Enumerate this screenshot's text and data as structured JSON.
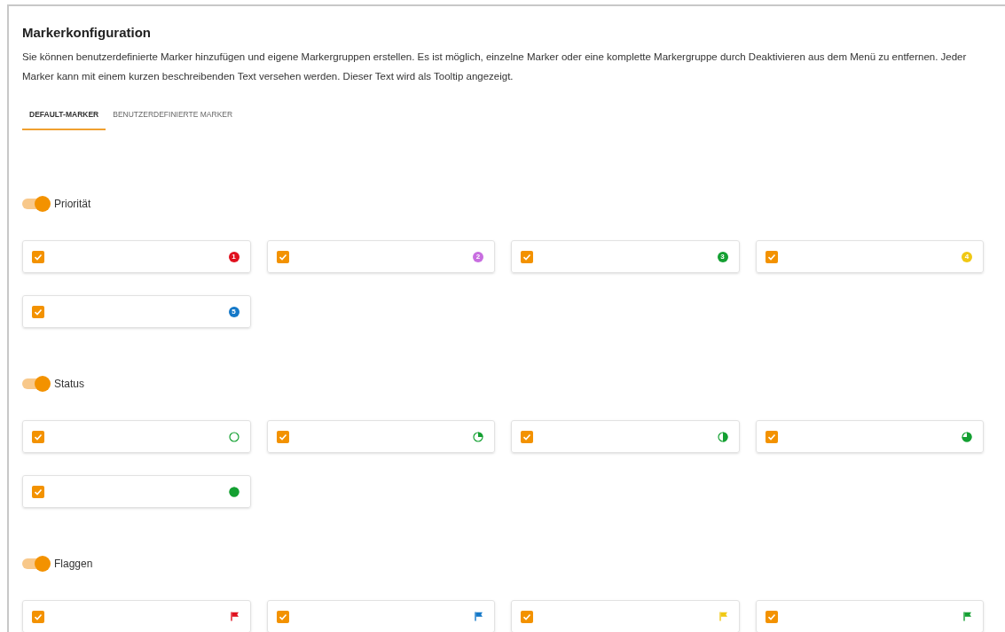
{
  "title": "Markerkonfiguration",
  "description": "Sie können benutzerdefinierte Marker hinzufügen und eigene Markergruppen erstellen. Es ist möglich, einzelne Marker oder eine komplette Markergruppe durch Deaktivieren aus dem Menü zu entfernen. Jeder Marker kann mit einem kurzen beschreibenden Text versehen werden. Dieser Text wird als Tooltip angezeigt.",
  "tabs": [
    {
      "label": "DEFAULT-MARKER",
      "selected": true
    },
    {
      "label": "BENUTZERDEFINIERTE MARKER",
      "selected": false
    }
  ],
  "groups": [
    {
      "label": "Priorität",
      "on": true,
      "markers": [
        {
          "checked": true,
          "kind": "number",
          "number": "1",
          "color": "#e0101e"
        },
        {
          "checked": true,
          "kind": "number",
          "number": "2",
          "color": "#c86ee0"
        },
        {
          "checked": true,
          "kind": "number",
          "number": "3",
          "color": "#14a032"
        },
        {
          "checked": true,
          "kind": "number",
          "number": "4",
          "color": "#f0c814"
        },
        {
          "checked": true,
          "kind": "number",
          "number": "5",
          "color": "#1478c8"
        }
      ]
    },
    {
      "label": "Status",
      "on": true,
      "markers": [
        {
          "checked": true,
          "kind": "empty"
        },
        {
          "checked": true,
          "kind": "quarter"
        },
        {
          "checked": true,
          "kind": "half"
        },
        {
          "checked": true,
          "kind": "threequarter"
        },
        {
          "checked": true,
          "kind": "full"
        }
      ]
    },
    {
      "label": "Flaggen",
      "on": true,
      "markers": [
        {
          "checked": true,
          "kind": "flag",
          "color": "#e0101e"
        },
        {
          "checked": true,
          "kind": "flag",
          "color": "#1478c8"
        },
        {
          "checked": true,
          "kind": "flag",
          "color": "#f0c814"
        },
        {
          "checked": true,
          "kind": "flag",
          "color": "#14a032"
        }
      ]
    }
  ]
}
